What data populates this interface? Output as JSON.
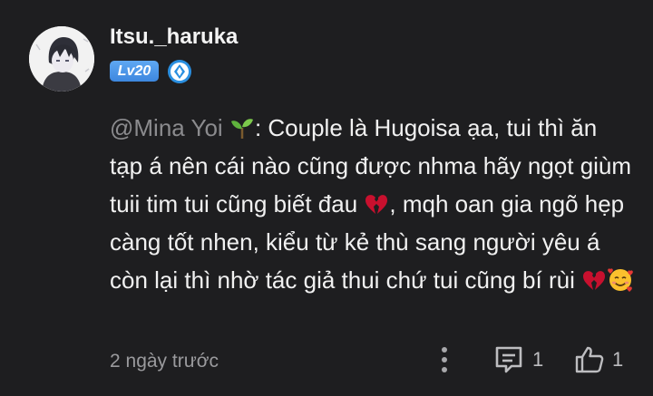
{
  "comment": {
    "author": {
      "username": "Itsu._haruka",
      "level_badge": "Lv20",
      "avatar_icon": "anime-avatar",
      "rank_icon": "diamond-rank-icon"
    },
    "mention": "@Mina Yoi",
    "mention_emoji": "seedling-icon",
    "mention_sep": ":",
    "text_part1": " Couple là Hugoisa ạa, tui thì ăn tạp á nên cái nào cũng được nhma hãy ngọt giùm tuii tim tui cũng biết đau ",
    "text_part2": ", mqh oan gia ngõ hẹp càng tốt nhen, kiểu từ kẻ thù sang người yêu á còn lại thì nhờ tác giả thui chứ tui cũng bí rùi ",
    "inline_emojis": [
      "broken-heart-icon",
      "broken-heart-icon",
      "smiling-face-with-hearts-icon"
    ],
    "timestamp": "2 ngày trước",
    "actions": {
      "more_icon": "vertical-dots-icon",
      "reply_icon": "comment-icon",
      "reply_count": "1",
      "like_icon": "thumbs-up-icon",
      "like_count": "1"
    }
  },
  "colors": {
    "background": "#1e1e20",
    "text": "#f1f1f1",
    "muted": "#8b8b8e",
    "badge": "#4a95e8"
  }
}
